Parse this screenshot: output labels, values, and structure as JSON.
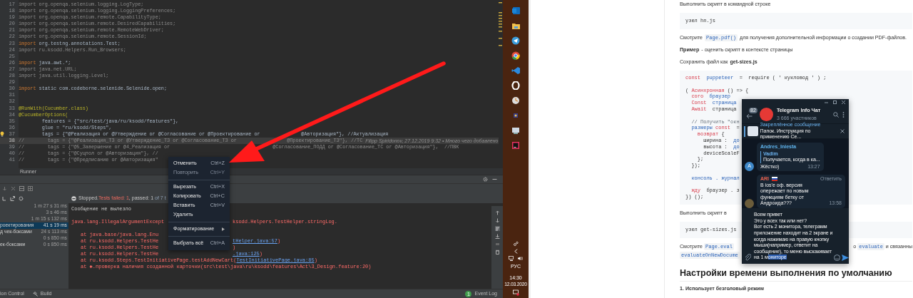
{
  "editor": {
    "lines": [
      {
        "number": "17",
        "text": "import org.openqa.selenium.logging.LogType;",
        "kind": "dim",
        "hint": false,
        "current": false
      },
      {
        "number": "18",
        "text": "import org.openqa.selenium.logging.LoggingPreferences;",
        "kind": "dim",
        "hint": false,
        "current": false
      },
      {
        "number": "19",
        "text": "import org.openqa.selenium.remote.CapabilityType;",
        "kind": "dim",
        "hint": false,
        "current": false
      },
      {
        "number": "20",
        "text": "import org.openqa.selenium.remote.DesiredCapabilities;",
        "kind": "dim",
        "hint": false,
        "current": false
      },
      {
        "number": "21",
        "text": "import org.openqa.selenium.remote.RemoteWebDriver;",
        "kind": "dim",
        "hint": false,
        "current": false
      },
      {
        "number": "22",
        "text": "import org.openqa.selenium.remote.SessionId;",
        "kind": "dim",
        "hint": false,
        "current": false
      },
      {
        "number": "23",
        "text": "import org.testng.annotations.Test;",
        "kind": "import",
        "hint": false,
        "current": false
      },
      {
        "number": "24",
        "text": "import ru.ksodd.Helpers.Run_Browsers;",
        "kind": "dim",
        "hint": false,
        "current": false
      },
      {
        "number": "25",
        "kind": "blank",
        "hint": false,
        "current": false
      },
      {
        "number": "26",
        "text": "import java.awt.*;",
        "kind": "import",
        "hint": false,
        "current": false
      },
      {
        "number": "27",
        "text": "import java.net.URL;",
        "kind": "dim",
        "hint": false,
        "current": false
      },
      {
        "number": "28",
        "text": "import java.util.logging.Level;",
        "kind": "dim",
        "hint": false,
        "current": false
      },
      {
        "number": "29",
        "kind": "blank",
        "hint": false,
        "current": false
      },
      {
        "number": "30",
        "text": "import static com.codeborne.selenide.Selenide.open;",
        "kind": "import",
        "hint": false,
        "current": false
      },
      {
        "number": "31",
        "kind": "blank",
        "hint": false,
        "current": false
      },
      {
        "number": "32",
        "kind": "blank",
        "hint": false,
        "current": false
      },
      {
        "number": "33",
        "text": "@RunWith(Cucumber.class)",
        "kind": "annotation",
        "hint": false,
        "current": false
      },
      {
        "number": "34",
        "text": "@CucumberOptions(",
        "kind": "annotation",
        "hint": false,
        "current": false
      },
      {
        "number": "35",
        "text": "        features = {\"src/test/java/ru/ksodd/features\"},",
        "kind": "code",
        "hint": false,
        "current": false
      },
      {
        "number": "36",
        "text": "        glue = \"ru/ksodd/Steps\",",
        "kind": "code",
        "hint": false,
        "current": false
      },
      {
        "number": "37",
        "text": "        tags = {\"@Реализация or @Утверждение or @Согласование or @Проектирование or",
        "tail": "@Авторизация\"}, //Актуализация",
        "kind": "code",
        "hint": true,
        "current": false
      },
      {
        "number": "38",
        "text": "//        tags = {\"@Реализация_ТЗ or @Утверждение_ТЗ or @Согласование_ТЗ or",
        "tail": "@Проектирование_ТЗ\"}, //ТС",
        "blame": "Filipp Spiridonov, 27.12.2019 9:32 • Много чего добавлено",
        "kind": "comment",
        "hint": false,
        "current": true
      },
      {
        "number": "39",
        "text": "//        tags = {\"@5_Завершение or @4_Реализация or",
        "tail": "@Согласование_ПОДД or @Согласование_ТС or @Авторизация\"},  //ПВК",
        "kind": "comment",
        "hint": false,
        "current": false
      },
      {
        "number": "40",
        "text": "//        tags = {\"@Суцпол or @Авторизация\"}, //",
        "kind": "comment",
        "hint": false,
        "current": false
      },
      {
        "number": "41",
        "text": "//        tags = {\"@Предписание or @Авторизация\"",
        "kind": "comment",
        "hint": false,
        "current": false
      }
    ],
    "breadcrumb": "Runner"
  },
  "run_panel": {
    "status": [
      {
        "text": "Stopped.",
        "kind": "plain"
      },
      {
        "text": "Tests failed: 1",
        "kind": "failed"
      },
      {
        "text": ", passed: 1",
        "kind": "plain"
      },
      {
        "text": " of 7 t",
        "kind": "muted"
      }
    ],
    "tree": [
      {
        "time": "1 m 27 s 31 ms",
        "selected": false
      },
      {
        "time": "3 s 46 ms",
        "selected": false
      },
      {
        "time": "1 m 15 s 132 ms",
        "selected": false
      },
      {
        "label": "роектирования",
        "time": "41 s 19 ms",
        "selected": true
      },
      {
        "label": "д чек-боксами",
        "time": "24 s 113 ms",
        "selected": false
      },
      {
        "time": "0 s 850 ms",
        "selected": false
      },
      {
        "label": "ек-боксами",
        "time": "0 s 850 ms",
        "selected": false
      }
    ],
    "console": [
      {
        "kind": "message",
        "parts": [
          {
            "text": "Сообщение не вылезло",
            "link": false
          }
        ]
      },
      {
        "kind": "blank"
      },
      {
        "kind": "error",
        "parts": [
          {
            "text": "java.lang.IllegalArgumentExcept",
            "link": false
          }
        ],
        "resume": [
          {
            "text": "ksodd.Helpers.TestHelper.stringLog.",
            "link": false
          }
        ]
      },
      {
        "kind": "blank"
      },
      {
        "kind": "trace",
        "parts": [
          {
            "text": "at java.base/java.lang.Enu",
            "link": false
          }
        ]
      },
      {
        "kind": "trace",
        "parts": [
          {
            "text": "at ru.ksodd.Helpers.TestHe",
            "link": false
          }
        ],
        "resume": [
          {
            "text": "tHelper.java:57",
            "link": true
          },
          {
            "text": ")",
            "link": false
          }
        ]
      },
      {
        "kind": "trace",
        "parts": [
          {
            "text": "at ru.ksodd.Helpers.TestHe",
            "link": false
          }
        ],
        "resume": [
          {
            "text": ")",
            "link": false
          }
        ]
      },
      {
        "kind": "trace",
        "parts": [
          {
            "text": "at ru.ksodd.Helpers.TestHe",
            "link": false
          }
        ],
        "resume": [
          {
            "text": ".java:125",
            "link": true
          },
          {
            "text": ")",
            "link": false
          }
        ]
      },
      {
        "kind": "trace",
        "parts": [
          {
            "text": "at ru.ksodd.Steps.TestInitiativePage.testAddNewCart(",
            "link": false
          },
          {
            "text": "TestInitiativePage.java:85",
            "link": true
          },
          {
            "text": ")",
            "link": false
          }
        ]
      },
      {
        "kind": "trace",
        "parts": [
          {
            "text": "at ✱.проверка наличия созданной карточки(src\\test\\java\\ru\\ksodd\\features\\Act\\3_Design.feature:20)",
            "link": false
          }
        ]
      }
    ]
  },
  "context_menu": [
    {
      "kind": "item",
      "label": "Отменить",
      "shortcut": "Ctrl+Z",
      "disabled": false
    },
    {
      "kind": "item",
      "label": "Повторить",
      "shortcut": "Ctrl+Y",
      "disabled": true
    },
    {
      "kind": "separator"
    },
    {
      "kind": "item",
      "label": "Вырезать",
      "shortcut": "Ctrl+X",
      "disabled": false
    },
    {
      "kind": "item",
      "label": "Копировать",
      "shortcut": "Ctrl+C",
      "disabled": false
    },
    {
      "kind": "item",
      "label": "Вставить",
      "shortcut": "Ctrl+V",
      "disabled": false
    },
    {
      "kind": "item",
      "label": "Удалить",
      "disabled": false
    },
    {
      "kind": "separator"
    },
    {
      "kind": "submenu",
      "label": "Форматирование",
      "disabled": false
    },
    {
      "kind": "separator"
    },
    {
      "kind": "item",
      "label": "Выбрать всё",
      "shortcut": "Ctrl+A",
      "disabled": false
    }
  ],
  "status_bar": {
    "items": [
      "ion Control",
      "Build"
    ],
    "event_log": {
      "count": "1",
      "label": "Event Log"
    }
  },
  "taskbar": {
    "language": "РУС",
    "time": "14:30",
    "date": "12.03.2020"
  },
  "document": {
    "blocks": [
      {
        "kind": "para",
        "parts": [
          {
            "text": "Выполнить скрипт в командной строке",
            "kind": "text"
          }
        ]
      },
      {
        "kind": "code",
        "lines": [
          {
            "kind": "code",
            "tokens": [
              {
                "text": "узел hn.js",
                "kind": "plain"
              }
            ]
          }
        ]
      },
      {
        "kind": "para",
        "parts": [
          {
            "text": "Смотрите",
            "kind": "text"
          },
          {
            "text": "Page.pdf()",
            "kind": "code"
          },
          {
            "text": "для получения дополнительной информации о создании PDF-файлов.",
            "kind": "text"
          }
        ]
      },
      {
        "kind": "para",
        "parts": [
          {
            "text": "Пример",
            "kind": "bold"
          },
          {
            "text": "- оценить скрипт в контексте страницы",
            "kind": "text"
          }
        ]
      },
      {
        "kind": "para",
        "parts": [
          {
            "text": "Сохранить файл как",
            "kind": "text"
          },
          {
            "text": "get-sizes.js",
            "kind": "bold"
          }
        ]
      },
      {
        "kind": "code",
        "lines": [
          {
            "kind": "code",
            "tokens": [
              {
                "text": "const",
                "kind": "kw"
              },
              {
                "text": "  puppeteer",
                "kind": "fn"
              },
              {
                "text": "  =  require ( ' кукловод ' ) ;",
                "kind": "plain"
              }
            ]
          },
          {
            "kind": "blank"
          },
          {
            "kind": "code",
            "tokens": [
              {
                "text": "( ",
                "kind": "plain"
              },
              {
                "text": "Асинхронная",
                "kind": "kw"
              },
              {
                "text": " () => {",
                "kind": "plain"
              }
            ]
          },
          {
            "kind": "code",
            "tokens": [
              {
                "text": "  coro",
                "kind": "kw"
              },
              {
                "text": "  браузер",
                "kind": "fn"
              }
            ]
          },
          {
            "kind": "code",
            "tokens": [
              {
                "text": "  Const",
                "kind": "kw"
              },
              {
                "text": "  страница",
                "kind": "fn"
              }
            ]
          },
          {
            "kind": "code",
            "tokens": [
              {
                "text": "  Await",
                "kind": "kw"
              },
              {
                "text": "  страница",
                "kind": "plain"
              }
            ]
          },
          {
            "kind": "blank"
          },
          {
            "kind": "code",
            "tokens": [
              {
                "text": "  // Получить \"окн",
                "kind": "comment"
              }
            ]
          },
          {
            "kind": "code",
            "tokens": [
              {
                "text": "  размеры",
                "kind": "fn"
              },
              {
                "text": " const",
                "kind": "kw"
              },
              {
                "text": "  =",
                "kind": "plain"
              }
            ]
          },
          {
            "kind": "code",
            "tokens": [
              {
                "text": "    возврат",
                "kind": "kw"
              },
              {
                "text": " {",
                "kind": "plain"
              }
            ]
          },
          {
            "kind": "code",
            "tokens": [
              {
                "text": "      ширина :  ",
                "kind": "plain"
              },
              {
                "text": "до",
                "kind": "fn"
              }
            ]
          },
          {
            "kind": "code",
            "tokens": [
              {
                "text": "      высота :  ",
                "kind": "plain"
              },
              {
                "text": "до",
                "kind": "fn"
              }
            ]
          },
          {
            "kind": "code",
            "tokens": [
              {
                "text": "      deviceScaleF",
                "kind": "plain"
              }
            ]
          },
          {
            "kind": "code",
            "tokens": [
              {
                "text": "    };",
                "kind": "plain"
              }
            ]
          },
          {
            "kind": "code",
            "tokens": [
              {
                "text": "  });",
                "kind": "plain"
              }
            ]
          },
          {
            "kind": "blank"
          },
          {
            "kind": "code",
            "tokens": [
              {
                "text": "  консоль . журнал",
                "kind": "fn"
              }
            ]
          },
          {
            "kind": "blank"
          },
          {
            "kind": "code",
            "tokens": [
              {
                "text": "  жду",
                "kind": "kw"
              },
              {
                "text": "  браузер . з",
                "kind": "plain"
              }
            ]
          },
          {
            "kind": "code",
            "tokens": [
              {
                "text": "}) ();",
                "kind": "plain"
              }
            ]
          }
        ]
      },
      {
        "kind": "para",
        "parts": [
          {
            "text": "Выполнить скрипт в",
            "kind": "text"
          }
        ]
      },
      {
        "kind": "code",
        "lines": [
          {
            "kind": "code",
            "tokens": [
              {
                "text": "узел get-sizes.js",
                "kind": "plain"
              }
            ]
          }
        ]
      },
      {
        "kind": "split",
        "parts": [
          {
            "text": "Смотрите",
            "kind": "text"
          },
          {
            "text": "Page.eval",
            "kind": "code"
          }
        ],
        "tail": [
          {
            "text": "о",
            "kind": "text"
          },
          {
            "text": "evaluate",
            "kind": "code"
          },
          {
            "text": "и связанны",
            "kind": "text"
          }
        ]
      },
      {
        "kind": "para",
        "parts": [
          {
            "text": "evaluateOnNewDocume",
            "kind": "code"
          }
        ]
      },
      {
        "kind": "heading",
        "parts": [
          {
            "text": "Настройки времени выполнения по умолчанию",
            "kind": "text"
          }
        ]
      },
      {
        "kind": "para",
        "parts": [
          {
            "text": "1. Использует безголовый режим",
            "kind": "bold"
          }
        ]
      }
    ]
  },
  "telegram": {
    "title": "Telegram Info Чат",
    "subtitle": "3 666 участников",
    "unread": "82",
    "pinned": {
      "title": "Закреплённое сообщение",
      "text": "Папок. Инструкция по применению  Се..."
    },
    "messages": [
      {
        "sender": "Andres_Iniesta",
        "color": "#5fb4ee",
        "avatar": "A",
        "reply": {
          "author": "Vadim",
          "text": "Получается, когда в ка..."
        },
        "text": "Жёстко)",
        "time": "13:27"
      },
      {
        "sender": "ARI",
        "color": "#e8614f",
        "flag": true,
        "action": "Ответить",
        "text": "В ios'e оф. версия опережает по новым функциям бетку от Андроида???",
        "time": "13:58"
      }
    ],
    "draft": {
      "lines": [
        "Всем привет",
        "Это у всех так или нет?",
        "Вот есть 2 монитора, телеграмм",
        "приложение находит на 2 экране и",
        "когда нажимаю на правую кнопку",
        "мыши(например, ответит на",
        "сообщение), то меню выскакивает",
        "на 1 м"
      ],
      "selection": "ониторе"
    }
  }
}
